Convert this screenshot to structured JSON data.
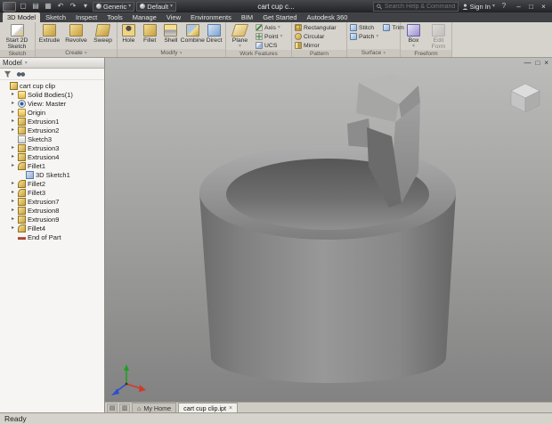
{
  "ui": {
    "chevron": "▾",
    "search_glyph": ""
  },
  "titlebar": {
    "icons": {
      "new": "▢",
      "open": "▤",
      "save": "▦",
      "undo": "↶",
      "redo": "↷",
      "qat_arrow": "▾",
      "help": "?"
    },
    "material_value": "Generic",
    "appearance_value": "Default",
    "doc_title": "cart cup c...",
    "search_placeholder": "Search Help & Commands...",
    "sign_in_label": "Sign In",
    "window": {
      "minimize": "–",
      "maximize": "□",
      "close": "×"
    }
  },
  "ribbon": {
    "tabs": [
      {
        "label": "3D Model",
        "active": true
      },
      {
        "label": "Sketch"
      },
      {
        "label": "Inspect"
      },
      {
        "label": "Tools"
      },
      {
        "label": "Manage"
      },
      {
        "label": "View"
      },
      {
        "label": "Environments"
      },
      {
        "label": "BIM"
      },
      {
        "label": "Get Started"
      },
      {
        "label": "Autodesk 360"
      }
    ],
    "sketch_panel": {
      "label": "Sketch",
      "start_2d_sketch": "Start 2D Sketch"
    },
    "create_panel": {
      "label": "Create",
      "extrude": "Extrude",
      "revolve": "Revolve",
      "sweep": "Sweep"
    },
    "modify_panel": {
      "label": "Modify",
      "hole": "Hole",
      "fillet": "Fillet",
      "shell": "Shell",
      "combine": "Combine",
      "direct": "Direct"
    },
    "work_panel": {
      "label": "Work Features",
      "plane": "Plane",
      "axis": "Axis",
      "point": "Point",
      "ucs": "UCS"
    },
    "pattern_panel": {
      "label": "Pattern",
      "rectangular": "Rectangular",
      "circular": "Circular",
      "mirror": "Mirror"
    },
    "surface_panel": {
      "label": "Surface",
      "stitch": "Stitch",
      "patch": "Patch",
      "trim": "Trim"
    },
    "freeform_panel": {
      "label": "Freeform",
      "box": "Box",
      "edit_form": "Edit Form"
    }
  },
  "browser": {
    "header": "Model",
    "tree": [
      {
        "label": "cart cup clip",
        "icon": "part",
        "lv": 0,
        "tw": ""
      },
      {
        "label": "Solid Bodies(1)",
        "icon": "folder",
        "lv": 1,
        "tw": "▸"
      },
      {
        "label": "View: Master",
        "icon": "eye",
        "lv": 1,
        "tw": "▸"
      },
      {
        "label": "Origin",
        "icon": "origin",
        "lv": 1,
        "tw": "▸"
      },
      {
        "label": "Extrusion1",
        "icon": "extrusion",
        "lv": 1,
        "tw": "▸"
      },
      {
        "label": "Extrusion2",
        "icon": "extrusion",
        "lv": 1,
        "tw": "▸"
      },
      {
        "label": "Sketch3",
        "icon": "sketch",
        "lv": 1,
        "tw": ""
      },
      {
        "label": "Extrusion3",
        "icon": "extrusion",
        "lv": 1,
        "tw": "▸"
      },
      {
        "label": "Extrusion4",
        "icon": "extrusion",
        "lv": 1,
        "tw": "▸"
      },
      {
        "label": "Fillet1",
        "icon": "fillet",
        "lv": 1,
        "tw": "▸"
      },
      {
        "label": "3D Sketch1",
        "icon": "sketch3d",
        "lv": 2,
        "tw": ""
      },
      {
        "label": "Fillet2",
        "icon": "fillet",
        "lv": 1,
        "tw": "▸"
      },
      {
        "label": "Fillet3",
        "icon": "fillet",
        "lv": 1,
        "tw": "▸"
      },
      {
        "label": "Extrusion7",
        "icon": "extrusion",
        "lv": 1,
        "tw": "▸"
      },
      {
        "label": "Extrusion8",
        "icon": "extrusion",
        "lv": 1,
        "tw": "▸"
      },
      {
        "label": "Extrusion9",
        "icon": "extrusion",
        "lv": 1,
        "tw": "▸"
      },
      {
        "label": "Fillet4",
        "icon": "fillet",
        "lv": 1,
        "tw": "▸"
      },
      {
        "label": "End of Part",
        "icon": "eop",
        "lv": 1,
        "tw": ""
      }
    ]
  },
  "viewport": {
    "controls": {
      "minimize": "—",
      "restore": "□",
      "close": "×"
    },
    "colors": {
      "bg_top": "#bcbcba",
      "bg_bottom": "#828282",
      "model_gray": "#8f8f8f"
    }
  },
  "doctabs": {
    "icons": {
      "grid": "▤",
      "list": "▥"
    },
    "home_label": "My Home",
    "doc_label": "cart cup clip.ipt",
    "close": "×"
  },
  "statusbar": {
    "ready": "Ready"
  }
}
